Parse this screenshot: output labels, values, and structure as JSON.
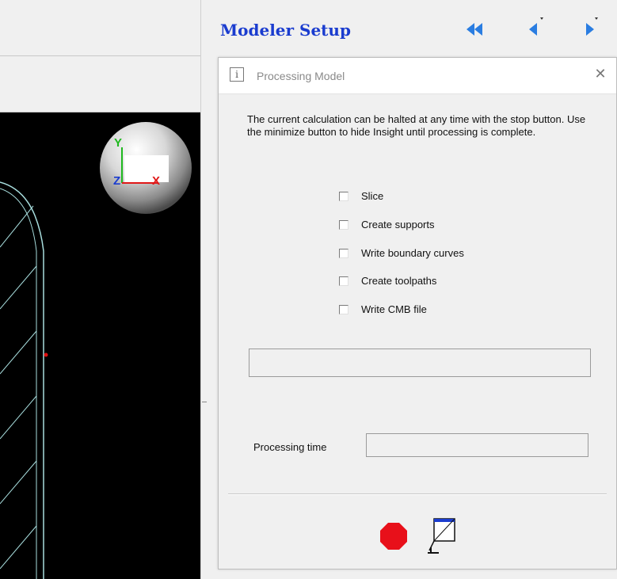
{
  "panel": {
    "title": "Modeler Setup",
    "nav_first_icon": "double-chevron-left-icon",
    "nav_prev_icon": "triangle-left-icon",
    "nav_next_icon": "triangle-right-icon"
  },
  "dialog": {
    "title": "Processing Model",
    "description": "The current  calculation can be halted at any time with the stop button. Use  the minimize button to hide Insight until processing  is complete.",
    "steps": [
      {
        "label": "Slice",
        "checked": false
      },
      {
        "label": "Create supports",
        "checked": false
      },
      {
        "label": "Write boundary curves",
        "checked": false
      },
      {
        "label": "Create toolpaths",
        "checked": false
      },
      {
        "label": "Write CMB file",
        "checked": false
      }
    ],
    "progress": 0,
    "processing_time_label": "Processing time",
    "processing_time_value": "",
    "stop_icon": "stop-octagon-icon",
    "minimize_icon": "minimize-window-icon"
  },
  "viewport": {
    "axes": {
      "y": "Y",
      "z": "Z",
      "x": "X"
    }
  },
  "colors": {
    "title_blue": "#1a3ccf",
    "nav_blue": "#2a7de1",
    "stop_red": "#e8101a",
    "viewport_bg": "#000000",
    "part_outline": "#a8dede"
  }
}
